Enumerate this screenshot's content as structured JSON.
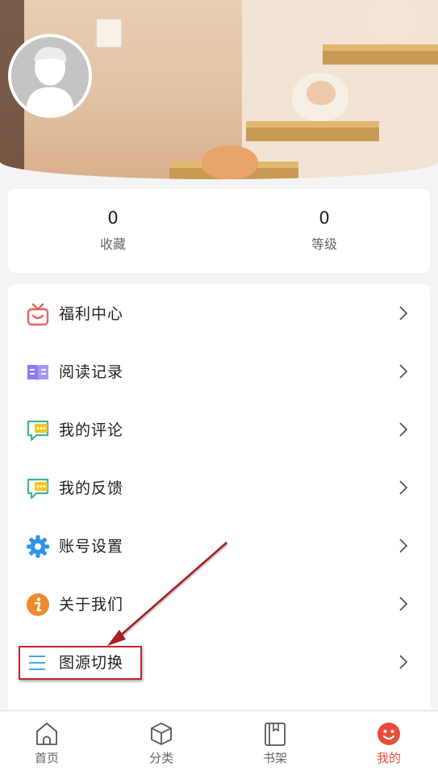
{
  "stats": [
    {
      "value": "0",
      "label": "收藏"
    },
    {
      "value": "0",
      "label": "等级"
    }
  ],
  "menu": [
    {
      "label": "福利中心",
      "icon": "gift-icon"
    },
    {
      "label": "阅读记录",
      "icon": "book-icon"
    },
    {
      "label": "我的评论",
      "icon": "comment-icon"
    },
    {
      "label": "我的反馈",
      "icon": "feedback-icon"
    },
    {
      "label": "账号设置",
      "icon": "gear-icon"
    },
    {
      "label": "关于我们",
      "icon": "info-icon"
    },
    {
      "label": "图源切换",
      "icon": "list-icon"
    }
  ],
  "tabs": [
    {
      "label": "首页",
      "icon": "home-icon",
      "active": false
    },
    {
      "label": "分类",
      "icon": "box-icon",
      "active": false
    },
    {
      "label": "书架",
      "icon": "bookshelf-icon",
      "active": false
    },
    {
      "label": "我的",
      "icon": "smiley-icon",
      "active": true
    }
  ],
  "colors": {
    "accent": "#e94c3d",
    "annotation": "#c0272d"
  }
}
